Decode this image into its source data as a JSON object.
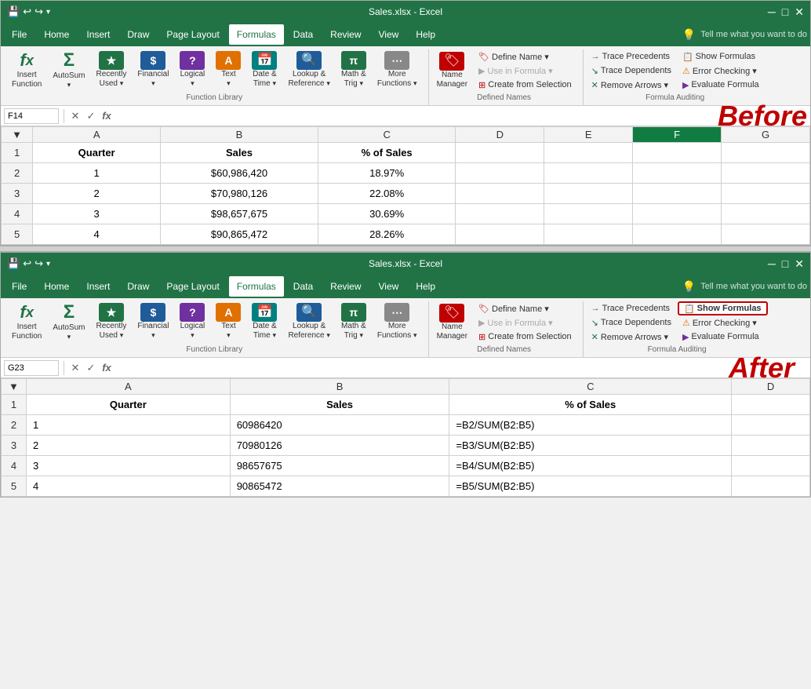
{
  "top_panel": {
    "title": "Sales.xlsx - Excel",
    "qat": [
      "💾",
      "↩",
      "↪",
      "🖰"
    ],
    "menu": [
      "File",
      "Home",
      "Insert",
      "Draw",
      "Page Layout",
      "Formulas",
      "Data",
      "Review",
      "View",
      "Help"
    ],
    "active_menu": "Formulas",
    "search_placeholder": "Tell me what you want to do",
    "ribbon_groups": [
      {
        "label": "Function Library",
        "buttons": [
          {
            "id": "insert-function",
            "icon": "fx",
            "label": "Insert\nFunction"
          },
          {
            "id": "autosum",
            "icon": "Σ",
            "label": "AutoSum"
          },
          {
            "id": "recently-used",
            "icon": "★",
            "label": "Recently\nUsed"
          },
          {
            "id": "financial",
            "icon": "$",
            "label": "Financial"
          },
          {
            "id": "logical",
            "icon": "?",
            "label": "Logical"
          },
          {
            "id": "text",
            "icon": "A",
            "label": "Text"
          },
          {
            "id": "date-time",
            "icon": "📅",
            "label": "Date &\nTime"
          },
          {
            "id": "lookup-ref",
            "icon": "🔍",
            "label": "Lookup &\nReference"
          },
          {
            "id": "math-trig",
            "icon": "π",
            "label": "Math &\nTrig"
          },
          {
            "id": "more-functions",
            "icon": "⋯",
            "label": "More\nFunctions"
          }
        ]
      },
      {
        "label": "Defined Names",
        "buttons_small": [
          {
            "id": "name-manager",
            "icon": "🏷",
            "label": "Name\nManager",
            "big": true
          },
          {
            "id": "define-name",
            "label": "▾ Define Name"
          },
          {
            "id": "use-in-formula",
            "label": "Use in Formula ▾"
          },
          {
            "id": "create-from-selection",
            "label": "Create from Selection"
          }
        ]
      },
      {
        "label": "Formula Auditing",
        "buttons_small": [
          {
            "id": "trace-precedents",
            "label": "Trace Precedents"
          },
          {
            "id": "trace-dependents",
            "label": "Trace Dependents"
          },
          {
            "id": "remove-arrows",
            "label": "Remove Arrows ▾"
          },
          {
            "id": "show-formulas",
            "label": "Show Formulas",
            "highlighted": false
          },
          {
            "id": "error-checking",
            "label": "Error Checking ▾"
          },
          {
            "id": "evaluate-formula",
            "label": "Evaluate Formula"
          }
        ]
      }
    ],
    "name_box": "F14",
    "label": "Before",
    "data": {
      "headers": [
        "Quarter",
        "Sales",
        "% of Sales"
      ],
      "rows": [
        [
          "1",
          "$60,986,420",
          "18.97%"
        ],
        [
          "2",
          "$70,980,126",
          "22.08%"
        ],
        [
          "3",
          "$98,657,675",
          "30.69%"
        ],
        [
          "4",
          "$90,865,472",
          "28.26%"
        ]
      ]
    }
  },
  "bottom_panel": {
    "title": "Sales.xlsx - Excel",
    "qat": [
      "💾",
      "↩",
      "↪",
      "🖰"
    ],
    "menu": [
      "File",
      "Home",
      "Insert",
      "Draw",
      "Page Layout",
      "Formulas",
      "Data",
      "Review",
      "View",
      "Help"
    ],
    "active_menu": "Formulas",
    "search_placeholder": "Tell me what you want to do",
    "name_box": "G23",
    "label": "After",
    "show_formulas_highlighted": true,
    "data": {
      "headers": [
        "Quarter",
        "Sales",
        "% of Sales"
      ],
      "rows": [
        [
          "1",
          "60986420",
          "=B2/SUM(B2:B5)"
        ],
        [
          "2",
          "70980126",
          "=B3/SUM(B2:B5)"
        ],
        [
          "3",
          "98657675",
          "=B4/SUM(B2:B5)"
        ],
        [
          "4",
          "90865472",
          "=B5/SUM(B2:B5)"
        ]
      ]
    }
  },
  "columns": {
    "before": [
      "",
      "A",
      "B",
      "C",
      "D",
      "E",
      "F",
      "G"
    ],
    "after": [
      "",
      "A",
      "B",
      "C",
      "D"
    ]
  }
}
